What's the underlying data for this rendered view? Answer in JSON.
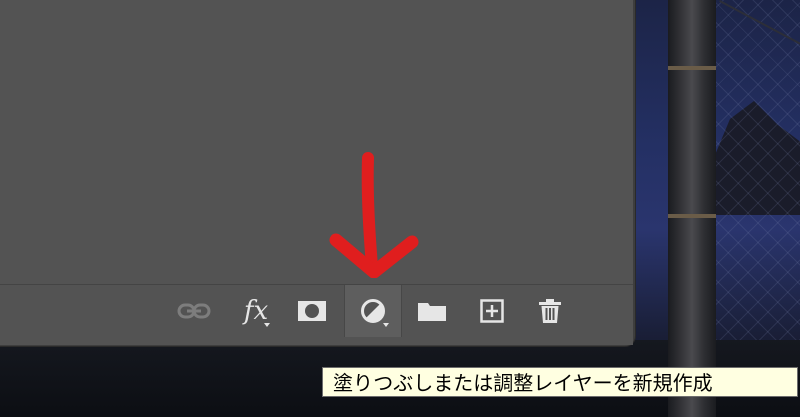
{
  "layers_panel": {
    "footer_buttons": [
      {
        "icon": "link-icon"
      },
      {
        "icon": "fx-icon",
        "label": "fx"
      },
      {
        "icon": "layer-mask-icon"
      },
      {
        "icon": "adjustment-layer-icon"
      },
      {
        "icon": "folder-icon"
      },
      {
        "icon": "new-layer-icon"
      },
      {
        "icon": "trash-icon"
      }
    ]
  },
  "tooltip": {
    "text": "塗りつぶしまたは調整レイヤーを新規作成"
  },
  "colors": {
    "panel_bg": "#535353",
    "icon": "#e6e6e6",
    "annotation_arrow": "#e01e1e",
    "tooltip_bg": "#ffffe1"
  }
}
